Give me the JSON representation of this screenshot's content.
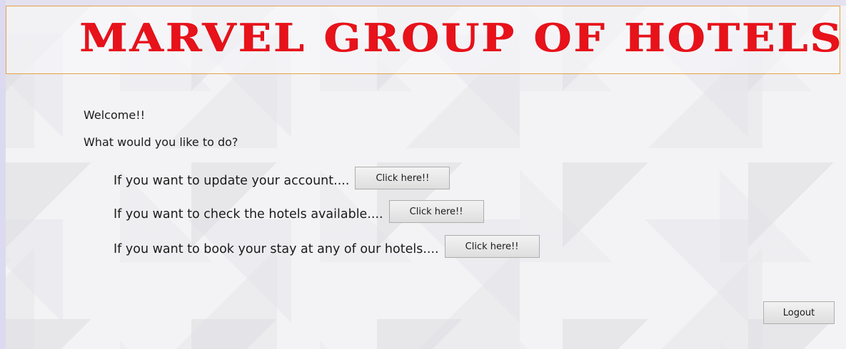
{
  "header": {
    "title": "MARVEL GROUP OF HOTELS",
    "title_color": "#e8121a",
    "border_color": "#e8a04a"
  },
  "main": {
    "welcome": "Welcome!!",
    "question": "What would you like to do?",
    "options": [
      {
        "label": "If you want to update your account....",
        "button": "Click here!!"
      },
      {
        "label": "If you want to check the hotels available....",
        "button": "Click here!!"
      },
      {
        "label": "If you want to book your stay at any of our hotels....",
        "button": "Click here!!"
      }
    ],
    "logout_label": "Logout"
  }
}
